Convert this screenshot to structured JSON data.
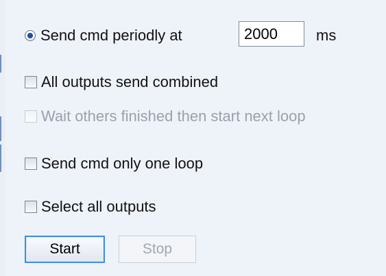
{
  "loop_settings": {
    "send_periodically": {
      "label": "Send cmd periodly at",
      "selected": true,
      "interval_value": "2000",
      "interval_unit": "ms"
    },
    "all_outputs_combined": {
      "label": "All outputs send combined",
      "checked": false
    },
    "wait_others_finished": {
      "label": "Wait others finished then start next loop",
      "checked": false,
      "enabled": false
    },
    "send_one_loop": {
      "label": "Send cmd only one loop",
      "checked": false
    },
    "select_all_outputs": {
      "label": "Select all outputs",
      "checked": false
    }
  },
  "buttons": {
    "start_label": "Start",
    "stop_label": "Stop"
  }
}
